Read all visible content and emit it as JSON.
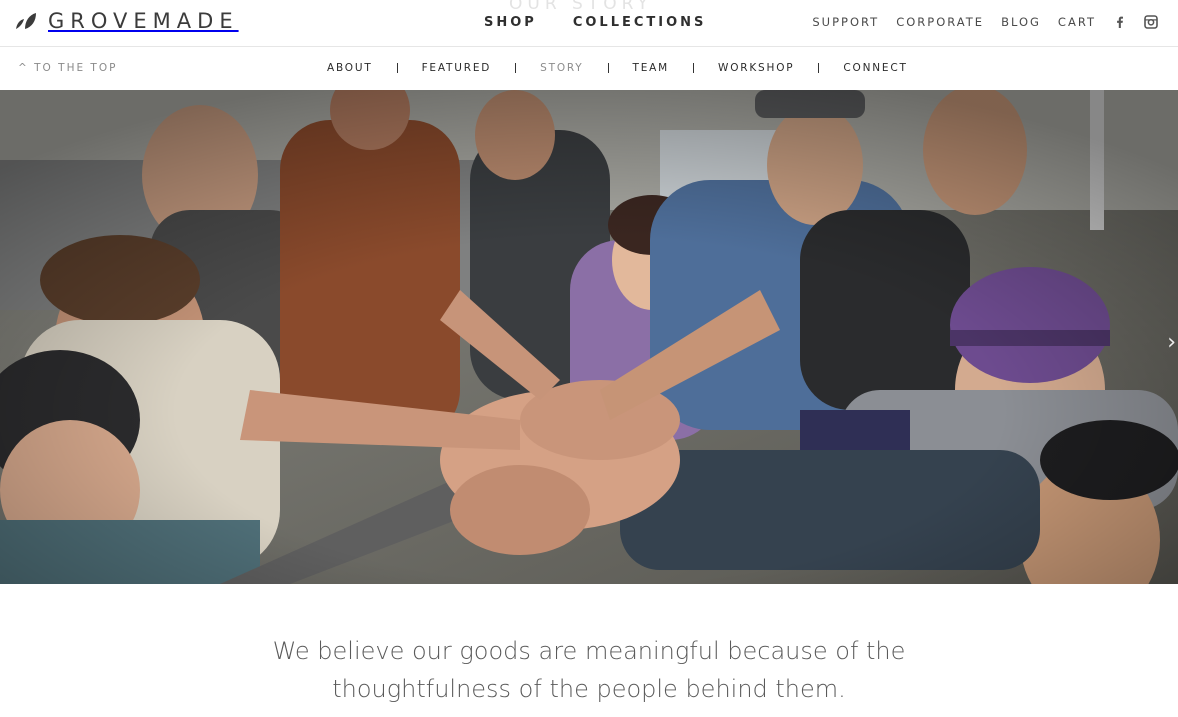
{
  "brand": {
    "name": "GROVEMADE"
  },
  "page_watermark": "OUR STORY",
  "main_nav": [
    {
      "label": "SHOP"
    },
    {
      "label": "COLLECTIONS"
    }
  ],
  "util_nav": [
    {
      "label": "SUPPORT"
    },
    {
      "label": "CORPORATE"
    },
    {
      "label": "BLOG"
    },
    {
      "label": "CART"
    }
  ],
  "social_icons": [
    "facebook-icon",
    "instagram-icon"
  ],
  "subnav": {
    "to_top": "^ TO THE TOP",
    "sections": [
      {
        "label": "ABOUT",
        "active": false
      },
      {
        "label": "FEATURED",
        "active": false
      },
      {
        "label": "STORY",
        "active": true
      },
      {
        "label": "TEAM",
        "active": false
      },
      {
        "label": "WORKSHOP",
        "active": false
      },
      {
        "label": "CONNECT",
        "active": false
      }
    ]
  },
  "hero": {
    "description_icon": "team-hands-together-photo"
  },
  "tagline": {
    "line1": "We believe our goods are meaningful because of the",
    "line2": "thoughtfulness of the people behind them."
  }
}
